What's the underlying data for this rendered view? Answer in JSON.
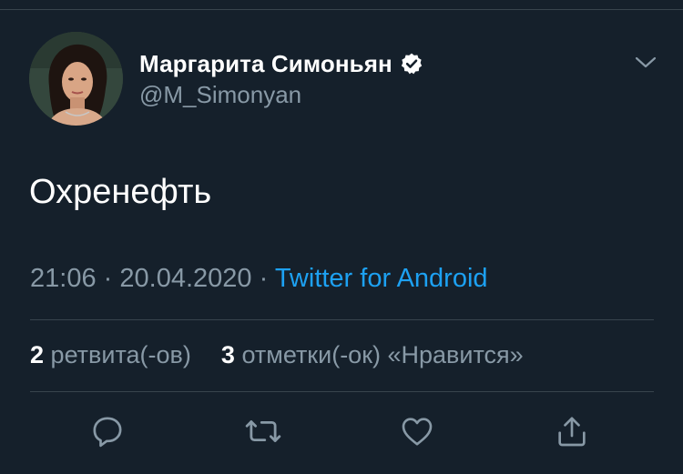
{
  "tweet": {
    "author": {
      "display_name": "Маргарита Симоньян",
      "handle": "@M_Simonyan",
      "verified": true
    },
    "text": "Охренефть",
    "time": "21:06",
    "separator": "·",
    "date": "20.04.2020",
    "source": "Twitter for Android",
    "stats": {
      "retweets_count": "2",
      "retweets_label": "ретвита(-ов)",
      "likes_count": "3",
      "likes_label": "отметки(-ок) «Нравится»"
    }
  },
  "actions": [
    "reply-icon",
    "retweet-icon",
    "like-icon",
    "share-icon"
  ],
  "colors": {
    "background": "#15202b",
    "text": "#ffffff",
    "muted": "#8899a6",
    "link": "#1da1f2",
    "divider": "#38444d"
  }
}
